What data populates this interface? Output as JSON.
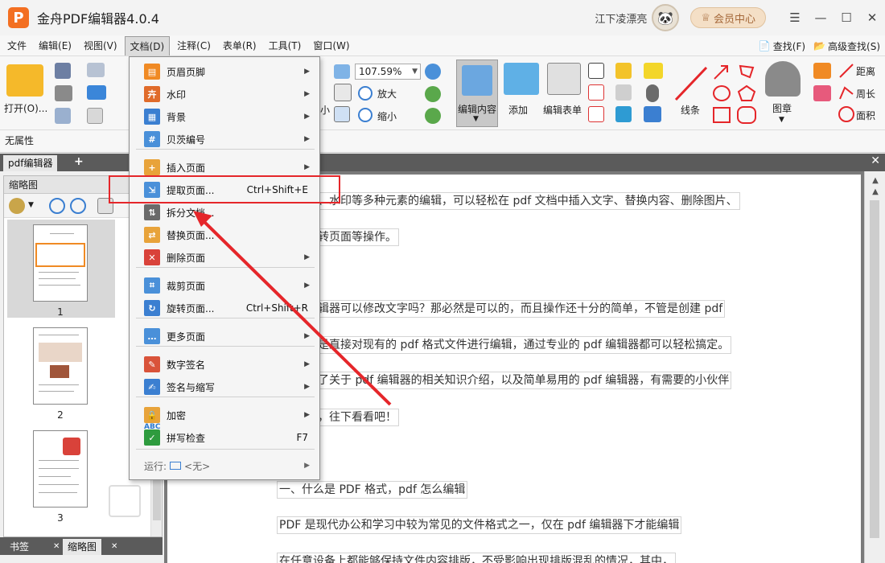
{
  "app": {
    "logo_letter": "P",
    "title": "金舟PDF编辑器4.0.4",
    "user_name": "江下凌漂亮",
    "vip_label": "会员中心",
    "window_controls": [
      "☰",
      "—",
      "☐",
      "✕"
    ]
  },
  "menubar": {
    "items": [
      {
        "label": "文件",
        "active": false
      },
      {
        "label": "编辑(E)",
        "active": false
      },
      {
        "label": "视图(V)",
        "active": false
      },
      {
        "label": "文档(D)",
        "active": true
      },
      {
        "label": "注释(C)",
        "active": false
      },
      {
        "label": "表单(R)",
        "active": false
      },
      {
        "label": "工具(T)",
        "active": false
      },
      {
        "label": "窗口(W)",
        "active": false
      }
    ],
    "find_label": "查找(F)",
    "adv_find_label": "高级查找(S)"
  },
  "toolbar": {
    "open_label": "打开(O)...",
    "zoom_value": "107.59%",
    "zoom_in_label": "放大",
    "zoom_out_label": "缩小",
    "partial_label": "小",
    "edit_content_label": "编辑内容",
    "add_label": "添加",
    "edit_form_label": "编辑表单",
    "line_label": "线条",
    "stamp_label": "图章",
    "distance_label": "距离",
    "perimeter_label": "周长",
    "area_label": "面积"
  },
  "status": {
    "text": "无属性"
  },
  "tabs": {
    "doc_tab": "pdf编辑器",
    "add": "+",
    "close": "✕"
  },
  "thumbnail_panel": {
    "title": "缩略图",
    "close": "✕",
    "pages": [
      "1",
      "2",
      "3"
    ]
  },
  "bottom_tabs": {
    "bookmark": "书签",
    "bookmark_close": "✕",
    "thumbnail": "缩略图",
    "thumbnail_close": "✕"
  },
  "document": {
    "lines": [
      "务、水印等多种元素的编辑，可以轻松在 pdf 文档中插入文字、替换内容、删除图片、",
      "旋转页面等操作。",
      "编辑器可以修改文字吗？那必然是可以的，而且操作还十分的简单，不管是创建 pdf",
      "还是直接对现有的 pdf 格式文件进行编辑，通过专业的 pdf 编辑器都可以轻松搞定。",
      "理了关于 pdf 编辑器的相关知识介绍，以及简单易用的 pdf 编辑器，有需要的小伙伴",
      "藏，往下看看吧！",
      "一、什么是 PDF 格式，pdf 怎么编辑",
      "PDF 是现代办公和学习中较为常见的文件格式之一，仅在 pdf 编辑器下才能编辑",
      "在任意设备上都能够保持文件内容排版，不受影响出现排版混乱的情况，其中，"
    ]
  },
  "dropdown": {
    "items": [
      {
        "label": "页眉页脚",
        "shortcut": "",
        "has_arrow": true,
        "icon": "header-footer-icon",
        "color": "#f08a24",
        "glyph": "▤"
      },
      {
        "label": "水印",
        "shortcut": "",
        "has_arrow": true,
        "icon": "watermark-icon",
        "color": "#e06b2a",
        "glyph": "卉"
      },
      {
        "label": "背景",
        "shortcut": "",
        "has_arrow": true,
        "icon": "background-icon",
        "color": "#3b7fd1",
        "glyph": "▦"
      },
      {
        "label": "贝茨编号",
        "shortcut": "",
        "has_arrow": true,
        "icon": "bates-number-icon",
        "color": "#4a90d9",
        "glyph": "#"
      },
      {
        "label": "插入页面",
        "shortcut": "",
        "has_arrow": true,
        "icon": "insert-page-icon",
        "color": "#e8a33a",
        "glyph": "+"
      },
      {
        "label": "提取页面...",
        "shortcut": "Ctrl+Shift+E",
        "has_arrow": false,
        "icon": "extract-page-icon",
        "color": "#4a90d9",
        "glyph": "⇲"
      },
      {
        "label": "拆分文档...",
        "shortcut": "",
        "has_arrow": false,
        "icon": "split-document-icon",
        "color": "#6a6a6a",
        "glyph": "⇅"
      },
      {
        "label": "替换页面...",
        "shortcut": "",
        "has_arrow": false,
        "icon": "replace-page-icon",
        "color": "#e8a33a",
        "glyph": "⇄"
      },
      {
        "label": "删除页面",
        "shortcut": "",
        "has_arrow": true,
        "icon": "delete-page-icon",
        "color": "#d9423a",
        "glyph": "✕"
      },
      {
        "label": "裁剪页面",
        "shortcut": "",
        "has_arrow": true,
        "icon": "crop-page-icon",
        "color": "#4a90d9",
        "glyph": "⌗"
      },
      {
        "label": "旋转页面...",
        "shortcut": "Ctrl+Shift+R",
        "has_arrow": false,
        "icon": "rotate-page-icon",
        "color": "#3b7fd1",
        "glyph": "↻"
      },
      {
        "label": "更多页面",
        "shortcut": "",
        "has_arrow": true,
        "icon": "more-pages-icon",
        "color": "#4a90d9",
        "glyph": "…"
      },
      {
        "label": "数字签名",
        "shortcut": "",
        "has_arrow": true,
        "icon": "digital-signature-icon",
        "color": "#d9533a",
        "glyph": "✎"
      },
      {
        "label": "签名与缩写",
        "shortcut": "",
        "has_arrow": true,
        "icon": "signature-initials-icon",
        "color": "#3b7fd1",
        "glyph": "✍"
      },
      {
        "label": "加密",
        "shortcut": "",
        "has_arrow": true,
        "icon": "encrypt-icon",
        "color": "#e8a33a",
        "glyph": "🔒"
      },
      {
        "label": "拼写检查",
        "shortcut": "F7",
        "has_arrow": false,
        "icon": "spell-check-icon",
        "color": "#2e9b3e",
        "glyph": "✓"
      }
    ],
    "run_label": "运行:",
    "run_value": "<无>",
    "tooltip_abc": "ABC"
  },
  "colors": {
    "highlight": "#e5262a",
    "arrow": "#e5262a",
    "logo": "#f36f21"
  }
}
